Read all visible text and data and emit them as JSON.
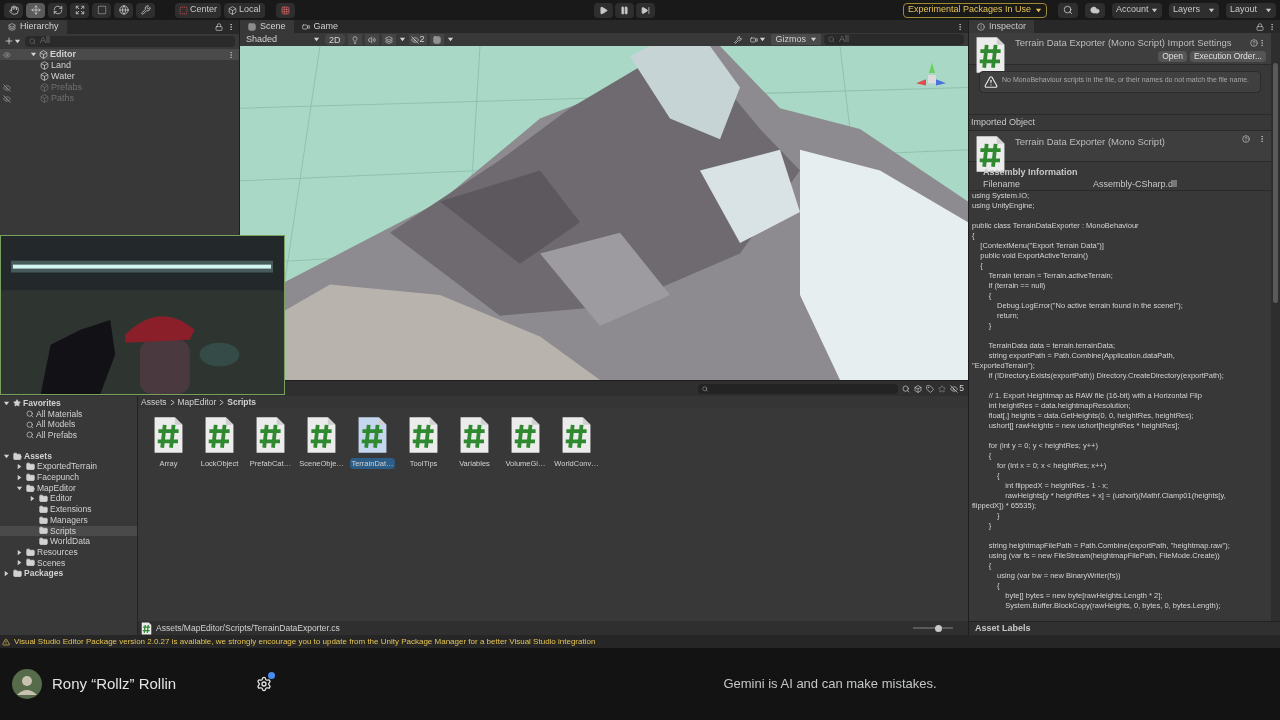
{
  "toolbar": {
    "tools": [
      {
        "kind": "hand",
        "selected": false
      },
      {
        "kind": "move",
        "selected": true
      },
      {
        "kind": "rotate",
        "selected": false
      },
      {
        "kind": "scale",
        "selected": false
      },
      {
        "kind": "rect",
        "selected": false
      },
      {
        "kind": "transform",
        "selected": false
      },
      {
        "kind": "custom",
        "selected": false
      }
    ],
    "pivot": [
      "Center",
      "Local"
    ],
    "playback": [
      {
        "kind": "play"
      },
      {
        "kind": "pause"
      },
      {
        "kind": "step"
      }
    ],
    "experimental_badge": "Experimental Packages In Use",
    "menus": [
      "Account",
      "Layers",
      "Layout"
    ]
  },
  "hierarchy": {
    "title": "Hierarchy",
    "search_placeholder": "All",
    "items": [
      {
        "label": "Editor",
        "kind": "scene",
        "expanded": true,
        "selected": true,
        "hidden": false,
        "children": [
          {
            "label": "Land",
            "kind": "object",
            "selected": false,
            "hidden": false
          },
          {
            "label": "Water",
            "kind": "object",
            "selected": false,
            "hidden": false
          },
          {
            "label": "Prefabs",
            "kind": "object",
            "selected": false,
            "hidden": true
          },
          {
            "label": "Paths",
            "kind": "object",
            "selected": false,
            "hidden": true
          }
        ]
      }
    ]
  },
  "scene": {
    "tabs": [
      {
        "label": "Scene",
        "selected": true
      },
      {
        "label": "Game",
        "selected": false
      }
    ],
    "shading": "Shaded",
    "mode_2d": "2D",
    "hidden_count": "2",
    "gizmos": "Gizmos",
    "search_placeholder": "All"
  },
  "project": {
    "hidden_count": "5",
    "breadcrumbs": [
      "Assets",
      "MapEditor",
      "Scripts"
    ],
    "tree": [
      {
        "label": "Favorites",
        "kind": "favorites",
        "expanded": true,
        "selected": false,
        "children": [
          {
            "label": "All Materials",
            "kind": "search",
            "selected": false
          },
          {
            "label": "All Models",
            "kind": "search",
            "selected": false
          },
          {
            "label": "All Prefabs",
            "kind": "search",
            "selected": false
          }
        ]
      },
      {
        "label": "Assets",
        "kind": "folder",
        "expanded": true,
        "selected": false,
        "children": [
          {
            "label": "ExportedTerrain",
            "kind": "folder",
            "expanded": false,
            "selected": false
          },
          {
            "label": "Facepunch",
            "kind": "folder",
            "expanded": false,
            "selected": false
          },
          {
            "label": "MapEditor",
            "kind": "folder",
            "expanded": true,
            "selected": false,
            "children": [
              {
                "label": "Editor",
                "kind": "folder",
                "expanded": false,
                "selected": false
              },
              {
                "label": "Extensions",
                "kind": "folder",
                "selected": false
              },
              {
                "label": "Managers",
                "kind": "folder",
                "selected": false
              },
              {
                "label": "Scripts",
                "kind": "folder",
                "selected": true
              },
              {
                "label": "WorldData",
                "kind": "folder",
                "selected": false
              }
            ]
          },
          {
            "label": "Resources",
            "kind": "folder",
            "expanded": false,
            "selected": false
          },
          {
            "label": "Scenes",
            "kind": "folder",
            "expanded": false,
            "selected": false
          }
        ]
      },
      {
        "label": "Packages",
        "kind": "folder",
        "expanded": false,
        "selected": false
      }
    ],
    "files": [
      {
        "label": "Array",
        "selected": false
      },
      {
        "label": "LockObject",
        "selected": false
      },
      {
        "label": "PrefabCat…",
        "selected": false
      },
      {
        "label": "SceneObje…",
        "selected": false
      },
      {
        "label": "TerrainDat…",
        "selected": true
      },
      {
        "label": "ToolTips",
        "selected": false
      },
      {
        "label": "Variables",
        "selected": false
      },
      {
        "label": "VolumeGi…",
        "selected": false
      },
      {
        "label": "WorldConv…",
        "selected": false
      }
    ],
    "path": "Assets/MapEditor/Scripts/TerrainDataExporter.cs",
    "zoom": {
      "level": 0.62
    }
  },
  "inspector": {
    "title": "Inspector",
    "header": "Terrain Data Exporter (Mono Script) Import Settings",
    "buttons": [
      "Open",
      "Execution Order..."
    ],
    "warning": "No MonoBehaviour scripts in the file, or their names do not match the file name.",
    "section_label": "Imported Object",
    "object_header": "Terrain Data Exporter (Mono Script)",
    "assembly_title": "Assembly Information",
    "assembly_rows": [
      {
        "label": "Filename",
        "value": "Assembly-CSharp.dll"
      }
    ],
    "code": "using System.IO;\nusing UnityEngine;\n\npublic class TerrainDataExporter : MonoBehaviour\n{\n    [ContextMenu(\"Export Terrain Data\")]\n    public void ExportActiveTerrain()\n    {\n        Terrain terrain = Terrain.activeTerrain;\n        if (terrain == null)\n        {\n            Debug.LogError(\"No active terrain found in the scene!\");\n            return;\n        }\n\n        TerrainData data = terrain.terrainData;\n        string exportPath = Path.Combine(Application.dataPath,\n\"ExportedTerrain\");\n        if (!Directory.Exists(exportPath)) Directory.CreateDirectory(exportPath);\n\n        // 1. Export Heightmap as RAW file (16-bit) with a Horizontal Flip\n        int heightRes = data.heightmapResolution;\n        float[,] heights = data.GetHeights(0, 0, heightRes, heightRes);\n        ushort[] rawHeights = new ushort[heightRes * heightRes];\n\n        for (int y = 0; y < heightRes; y++)\n        {\n            for (int x = 0; x < heightRes; x++)\n            {\n                int flippedX = heightRes - 1 - x;\n                rawHeights[y * heightRes + x] = (ushort)(Mathf.Clamp01(heights[y,\nflippedX]) * 65535);\n            }\n        }\n\n        string heightmapFilePath = Path.Combine(exportPath, \"heightmap.raw\");\n        using (var fs = new FileStream(heightmapFilePath, FileMode.Create))\n        {\n            using (var bw = new BinaryWriter(fs))\n            {\n                byte[] bytes = new byte[rawHeights.Length * 2];\n                System.Buffer.BlockCopy(rawHeights, 0, bytes, 0, bytes.Length);",
    "labels_title": "Asset Labels"
  },
  "console_warning": "Visual Studio Editor Package version 2.0.27 is available, we strongly encourage you to update from the Unity Package Manager for a better Visual Studio integration",
  "footer": {
    "user_name": "Rony “Rollz” Rollin",
    "settings_badge": true,
    "disclaimer": "Gemini is AI and can make mistakes."
  }
}
